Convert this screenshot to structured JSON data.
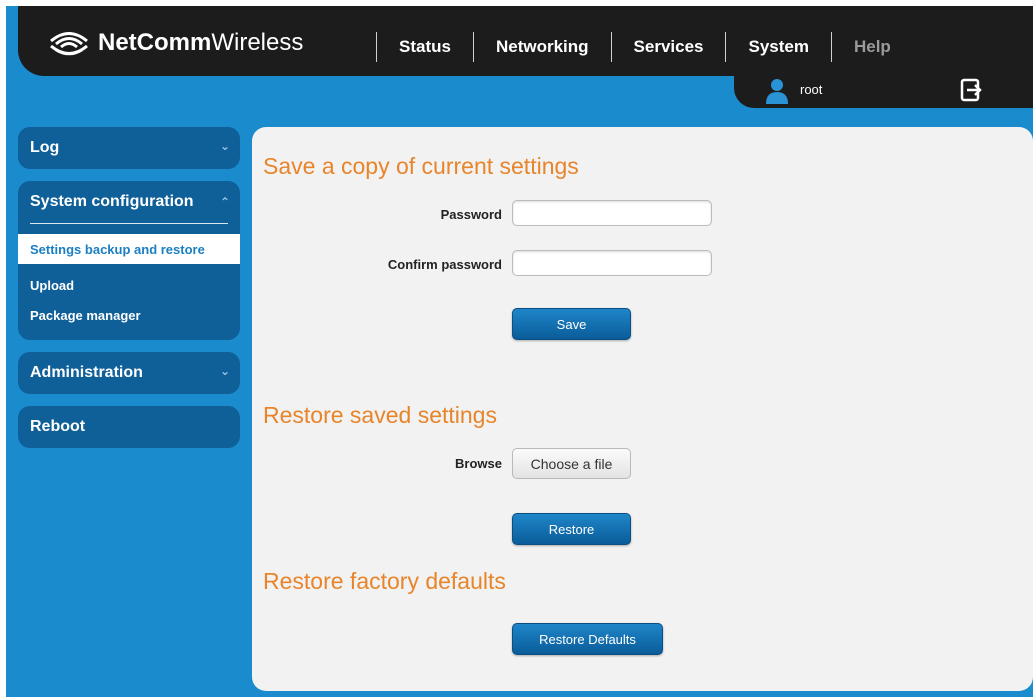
{
  "header": {
    "brand_bold": "NetComm",
    "brand_light": "Wireless",
    "nav": [
      "Status",
      "Networking",
      "Services",
      "System",
      "Help"
    ]
  },
  "user": {
    "name": "root",
    "icon": "user-icon",
    "logout_icon": "logout-icon"
  },
  "sidebar": {
    "log": "Log",
    "system_configuration": "System configuration",
    "items": [
      "Settings backup and restore",
      "Upload",
      "Package manager"
    ],
    "administration": "Administration",
    "reboot": "Reboot"
  },
  "main": {
    "save_section": {
      "title": "Save a copy of current settings",
      "password_label": "Password",
      "password_value": "",
      "confirm_label": "Confirm password",
      "confirm_value": "",
      "save_button": "Save"
    },
    "restore_section": {
      "title": "Restore saved settings",
      "browse_label": "Browse",
      "choose_file": "Choose a file",
      "restore_button": "Restore"
    },
    "factory_section": {
      "title": "Restore factory defaults",
      "defaults_button": "Restore Defaults"
    }
  },
  "colors": {
    "background": "#1a8bcc",
    "header": "#1c1c1c",
    "accent": "#e8852b",
    "sidebar": "#0f5f99",
    "active_item": "#1a7fc2"
  }
}
